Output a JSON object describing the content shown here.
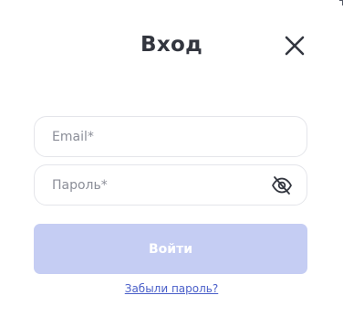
{
  "login_modal": {
    "title": "Вход",
    "close_icon": "close-icon",
    "email_field": {
      "value": "",
      "placeholder": "Email*"
    },
    "password_field": {
      "value": "",
      "placeholder": "Пароль*",
      "toggle_icon": "eye-slash-icon"
    },
    "submit_label": "Войти",
    "forgot_password_label": "Забыли пароль?"
  },
  "colors": {
    "title": "#33363f",
    "submit_disabled_bg": "#c5cdf3",
    "link": "#4a5fc9",
    "field_border": "#e4e5ea",
    "placeholder": "#8b8e98"
  }
}
